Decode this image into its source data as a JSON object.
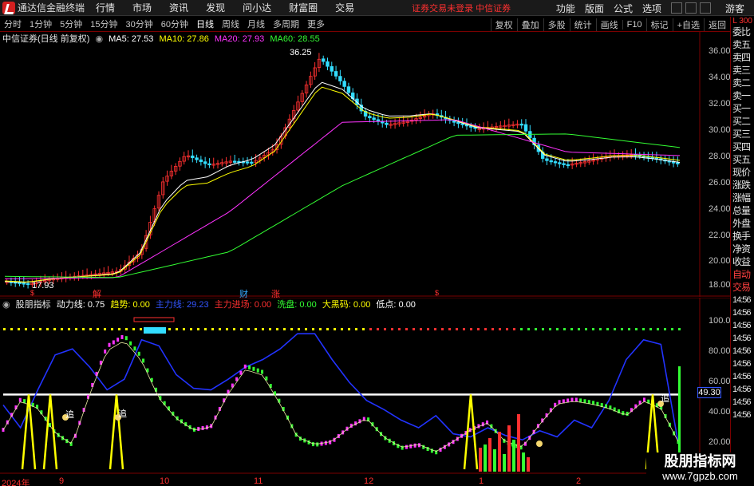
{
  "menubar": {
    "app_title": "通达信金融终端",
    "items": [
      "行情",
      "市场",
      "资讯",
      "发现",
      "问小达",
      "财富圈",
      "交易"
    ],
    "center_notice": "证券交易未登录 中信证券",
    "right_items": [
      "功能",
      "版面",
      "公式",
      "选项"
    ],
    "guest": "游客"
  },
  "toolbar": {
    "periods": [
      "分时",
      "1分钟",
      "5分钟",
      "15分钟",
      "30分钟",
      "60分钟",
      "日线",
      "周线",
      "月线",
      "多周期",
      "更多"
    ],
    "active_period": "日线",
    "right_buttons": [
      "复权",
      "叠加",
      "多股",
      "统计",
      "画线",
      "F10",
      "标记",
      "+自选",
      "返回"
    ]
  },
  "main_chart": {
    "stock_label": "中信证券(日线 前复权)",
    "ma_labels": [
      {
        "text": "MA5: 27.53",
        "color": "#ffffff"
      },
      {
        "text": "MA10: 27.86",
        "color": "#ffff00"
      },
      {
        "text": "MA20: 27.93",
        "color": "#ff33ff"
      },
      {
        "text": "MA60: 28.55",
        "color": "#33ff33"
      }
    ],
    "y_ticks": [
      "36.00",
      "34.00",
      "32.00",
      "30.00",
      "28.00",
      "26.00",
      "24.00",
      "22.00",
      "20.00",
      "18.00"
    ],
    "high_label": "36.25",
    "low_label": "17.93",
    "markers": [
      "解",
      "财",
      "涨",
      "$",
      "$"
    ]
  },
  "sub_chart": {
    "indicator_name": "股朋指标",
    "labels": [
      {
        "text": "动力线: 0.75",
        "color": "#ffffff"
      },
      {
        "text": "趋势: 0.00",
        "color": "#ffff00"
      },
      {
        "text": "主力线: 29.23",
        "color": "#3355ff"
      },
      {
        "text": "主力进场: 0.00",
        "color": "#ff3030"
      },
      {
        "text": "洗盘: 0.00",
        "color": "#33ff33"
      },
      {
        "text": "大黑码: 0.00",
        "color": "#ffff00"
      },
      {
        "text": "低点: 0.00",
        "color": "#ffffff"
      }
    ],
    "y_ticks": [
      "100.0",
      "80.00",
      "60.00",
      "40.00",
      "20.00"
    ],
    "current_value": "49.30",
    "chase_label": "追"
  },
  "x_axis": {
    "labels": [
      "2024年",
      "9",
      "10",
      "11",
      "12",
      "1",
      "2"
    ]
  },
  "side_panel": {
    "top_label": "L 300",
    "items": [
      "委比",
      "卖五",
      "卖四",
      "卖三",
      "卖二",
      "卖一",
      "买一",
      "买二",
      "买三",
      "买四",
      "买五",
      "现价",
      "涨跌",
      "涨幅",
      "总量",
      "外盘",
      "换手",
      "净资",
      "收益",
      "自动",
      "交易"
    ],
    "times": [
      "14:56",
      "14:56",
      "14:56",
      "14:56",
      "14:56",
      "14:56",
      "14:56",
      "14:56",
      "14:56",
      "14:56"
    ]
  },
  "watermark": {
    "line1": "股朋指标网",
    "line2": "www.7gpzb.com"
  },
  "colors": {
    "up": "#ff3030",
    "down": "#33ddff",
    "ma5": "#ffffff",
    "ma10": "#ffff00",
    "ma20": "#ff33ff",
    "ma60": "#33ff33",
    "main_line": "#2233ff"
  },
  "chart_data": [
    {
      "type": "line",
      "title": "",
      "ylim": [
        17,
        37
      ],
      "x": [
        "2024-08",
        "2024-09",
        "2024-10",
        "2024-11",
        "2024-12",
        "2025-01",
        "2025-02"
      ],
      "series": [
        {
          "name": "MA5",
          "values": [
            18.2,
            18.6,
            26.8,
            32.5,
            30.8,
            27.8,
            27.53
          ]
        },
        {
          "name": "MA10",
          "values": [
            18.3,
            18.5,
            25.5,
            31.8,
            30.9,
            28.0,
            27.86
          ]
        },
        {
          "name": "MA20",
          "values": [
            18.4,
            18.5,
            23.6,
            30.5,
            30.7,
            28.2,
            27.93
          ]
        },
        {
          "name": "MA60",
          "values": [
            18.6,
            18.5,
            20.5,
            25.6,
            29.5,
            29.6,
            28.55
          ]
        }
      ]
    }
  ]
}
